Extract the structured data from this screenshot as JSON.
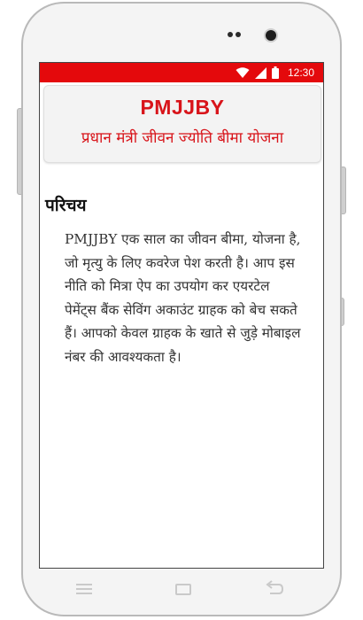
{
  "status_bar": {
    "time": "12:30",
    "icons": [
      "wifi-icon",
      "signal-icon",
      "battery-icon"
    ],
    "background": "#e4090c"
  },
  "header": {
    "title": "PMJJBY",
    "subtitle": "प्रधान मंत्री जीवन ज्योति बीमा योजना",
    "accent_color": "#d8141a"
  },
  "content": {
    "section_heading": "परिचय",
    "intro_text": "PMJJBY एक साल का जीवन बीमा, योजना है, जो मृत्यु के लिए कवरेज पेश करती है। आप इस नीति को मित्रा ऐप का उपयोग कर एयरटेल पेमेंट्स बैंक सेविंग अकाउंट ग्राहक को बेच सकते हैं। आपको केवल ग्राहक के खाते से जुड़े मोबाइल नंबर की आवश्यकता है।"
  },
  "nav_bar": {
    "icons": [
      "menu-icon",
      "home-icon",
      "back-icon"
    ]
  }
}
